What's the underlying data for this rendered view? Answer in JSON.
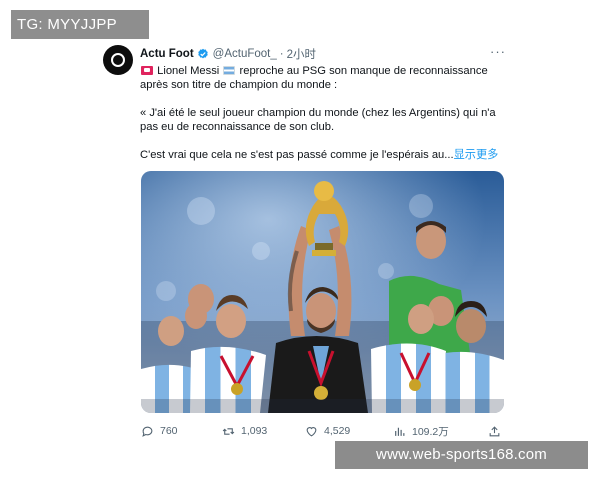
{
  "watermark_top": "TG: MYYJJPP",
  "watermark_bottom": "www.web-sports168.com",
  "tweet": {
    "author_name": "Actu Foot",
    "verified_icon": "verified-badge-icon",
    "handle": "@ActuFoot_",
    "separator": "·",
    "time": "2小时",
    "more_icon": "more-dots-icon",
    "more_label": "···",
    "line1_pre": " Lionel Messi ",
    "line1_post": " reproche au PSG son manque de reconnaissance après son titre de champion du monde :",
    "paragraph2": "« J'ai été le seul joueur champion du monde (chez les Argentins) qui n'a pas eu de reconnaissance de son club.",
    "paragraph3": "C'est vrai que cela ne s'est pas passé comme je l'espérais au...",
    "show_more": "显示更多",
    "media_description_icon": "photo-messi-world-cup-trophy",
    "actions": {
      "reply_count": "760",
      "retweet_count": "1,093",
      "like_count": "4,529",
      "views_count": "109.2万"
    }
  },
  "colors": {
    "accent_blue": "#1d9bf0",
    "text_primary": "#0f1419",
    "text_secondary": "#536471",
    "watermark_bg": "#8e8e8e"
  }
}
